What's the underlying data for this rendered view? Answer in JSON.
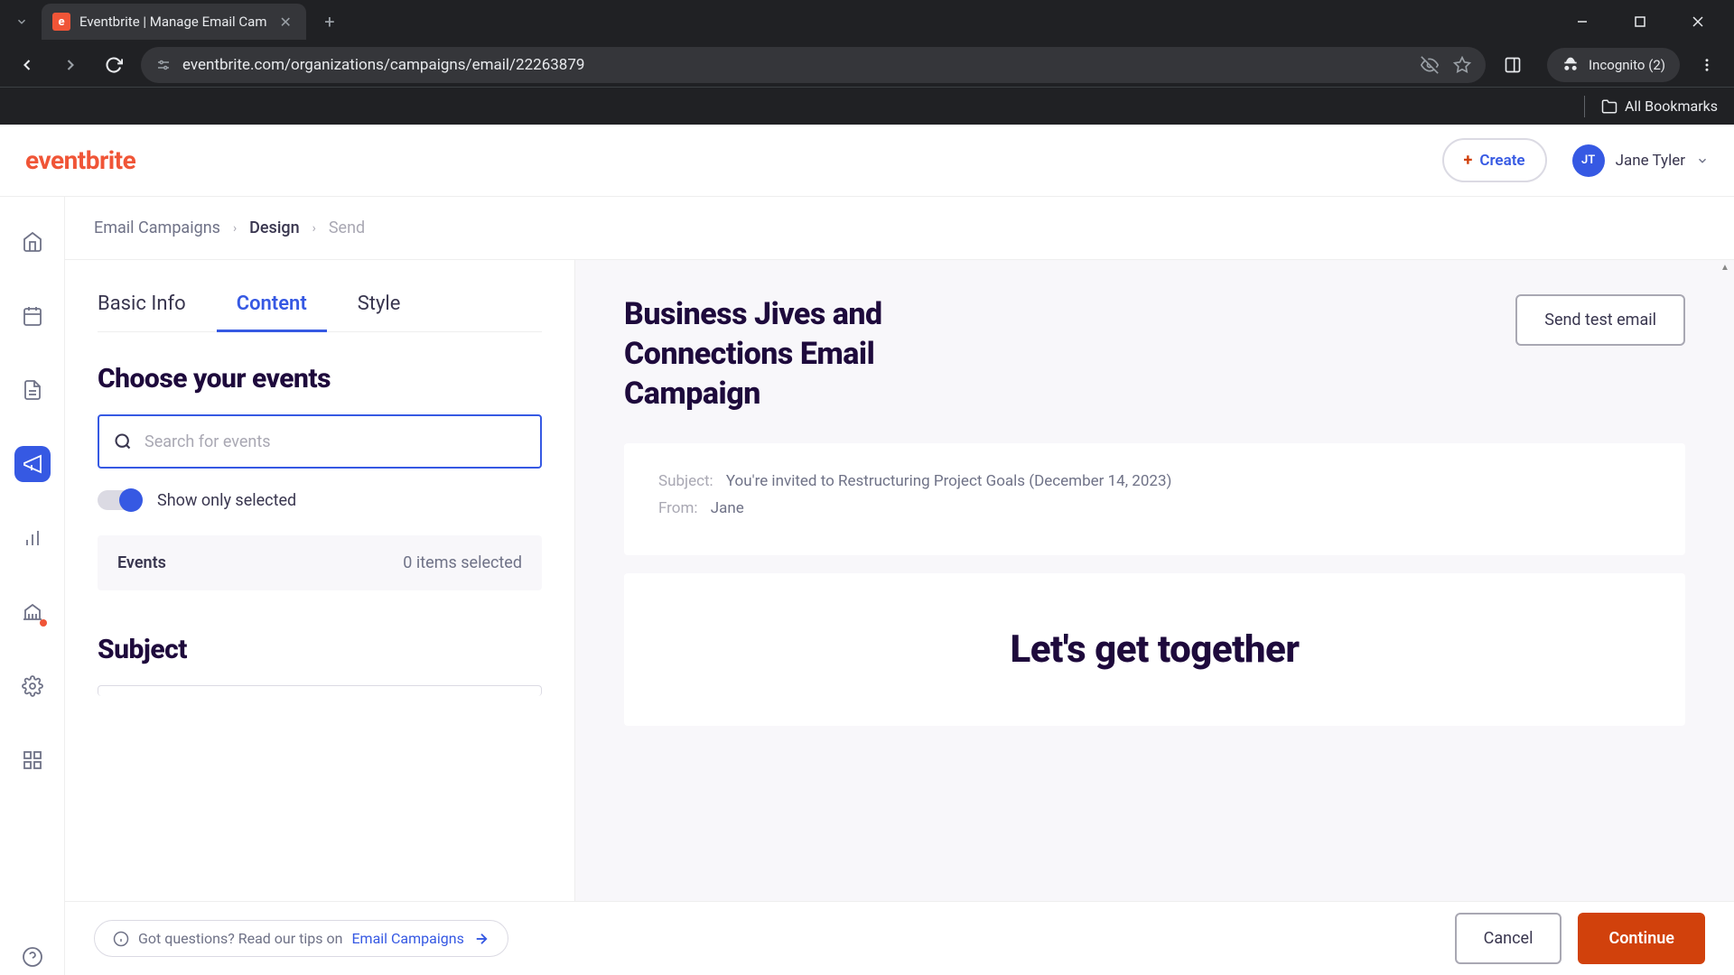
{
  "browser": {
    "tab_title": "Eventbrite | Manage Email Cam",
    "tab_favicon_letter": "e",
    "url": "eventbrite.com/organizations/campaigns/email/22263879",
    "incognito_label": "Incognito (2)",
    "all_bookmarks": "All Bookmarks"
  },
  "header": {
    "logo": "eventbrite",
    "create_label": "Create",
    "user_initials": "JT",
    "user_name": "Jane Tyler"
  },
  "breadcrumbs": {
    "items": [
      {
        "label": "Email Campaigns"
      },
      {
        "label": "Design"
      },
      {
        "label": "Send"
      }
    ]
  },
  "tabs": {
    "items": [
      {
        "label": "Basic Info"
      },
      {
        "label": "Content"
      },
      {
        "label": "Style"
      }
    ]
  },
  "left_panel": {
    "choose_events_title": "Choose your events",
    "search_placeholder": "Search for events",
    "show_only_selected": "Show only selected",
    "events_label": "Events",
    "items_selected": "0 items selected",
    "subject_title": "Subject"
  },
  "preview": {
    "campaign_title": "Business Jives and Connections Email Campaign",
    "send_test_label": "Send test email",
    "subject_label": "Subject:",
    "subject_value": "You're invited to Restructuring Project Goals (December 14, 2023)",
    "from_label": "From:",
    "from_value": "Jane",
    "headline": "Let's get together"
  },
  "footer": {
    "tip_prefix": "Got questions? Read our tips on ",
    "tip_link": "Email Campaigns",
    "cancel": "Cancel",
    "continue": "Continue"
  }
}
